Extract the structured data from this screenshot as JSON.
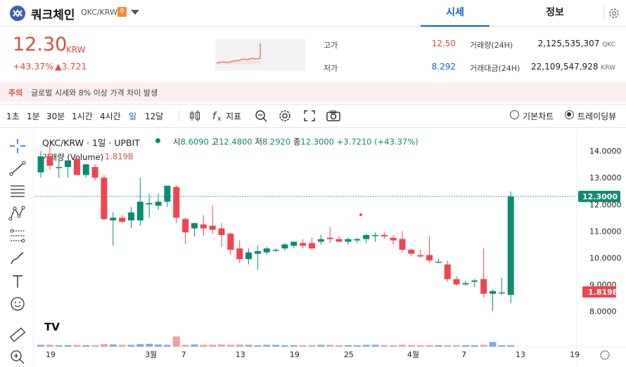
{
  "header": {
    "coin_name": "쿼크체인",
    "pair": "QKC/KRW",
    "badge": "주",
    "tabs": [
      {
        "label": "시세",
        "active": true
      },
      {
        "label": "정보",
        "active": false
      }
    ]
  },
  "summary": {
    "price": "12.30",
    "price_unit": "KRW",
    "change_pct": "+43.37%",
    "change_amt": "▲3.721",
    "high_label": "고가",
    "high_value": "12.50",
    "low_label": "저가",
    "low_value": "8.292",
    "volume_label": "거래량(24H)",
    "volume_value": "2,125,535,307",
    "volume_unit": "QKC",
    "amount_label": "거래대금(24H)",
    "amount_value": "22,109,547,928",
    "amount_unit": "KRW"
  },
  "notice": {
    "tag": "주의",
    "text": "글로벌 시세와 8% 이상 가격 차이 발생"
  },
  "toolbar": {
    "intervals": [
      "1초",
      "1분",
      "30분",
      "1시간",
      "4시간",
      "일",
      "12달"
    ],
    "selected_interval": "일",
    "indicator_label": "지표",
    "chart_modes": [
      {
        "label": "기본차트",
        "selected": false
      },
      {
        "label": "트레이딩뷰",
        "selected": true
      }
    ]
  },
  "chart_header": {
    "title": "QKC/KRW · 1일 · UPBIT",
    "open_label": "시",
    "open": "8.6090",
    "high_label": "고",
    "high": "12.4800",
    "low_label": "저",
    "low": "8.2920",
    "close_label": "종",
    "close": "12.3000",
    "change": "+3.7210 (+43.37%)",
    "volume_label": "거래량 (Volume)",
    "volume_value": "1.819B"
  },
  "colors": {
    "up": "#0e8a73",
    "down": "#f0444f",
    "price_red": "#d24f45",
    "accent_blue": "#1261c4",
    "up_vol": "#7fa8e8",
    "down_vol": "#eda0a5"
  },
  "chart_data": {
    "type": "candlestick",
    "title": "QKC/KRW · 1일 · UPBIT",
    "y_ticks": [
      "14.0000",
      "13.0000",
      "12.0000",
      "11.0000",
      "10.0000",
      "9.0000",
      "8.0000"
    ],
    "ylim": [
      7.3,
      14.4
    ],
    "x_ticks": [
      {
        "label": "19",
        "index": 1
      },
      {
        "label": "3월",
        "index": 12
      },
      {
        "label": "7",
        "index": 16
      },
      {
        "label": "13",
        "index": 22
      },
      {
        "label": "19",
        "index": 28
      },
      {
        "label": "25",
        "index": 34
      },
      {
        "label": "4월",
        "index": 41
      },
      {
        "label": "7",
        "index": 47
      },
      {
        "label": "13",
        "index": 53
      },
      {
        "label": "19",
        "index": 59
      }
    ],
    "last_price_label": "12.3000",
    "last_price": 12.3,
    "volume_label": "1.819B",
    "candles": [
      {
        "o": 13.2,
        "h": 14.0,
        "l": 13.0,
        "c": 13.8
      },
      {
        "o": 13.8,
        "h": 14.2,
        "l": 13.3,
        "c": 13.45
      },
      {
        "o": 13.4,
        "h": 13.7,
        "l": 13.0,
        "c": 13.4
      },
      {
        "o": 13.4,
        "h": 13.6,
        "l": 13.0,
        "c": 13.65
      },
      {
        "o": 13.7,
        "h": 13.75,
        "l": 13.1,
        "c": 13.1
      },
      {
        "o": 13.1,
        "h": 13.5,
        "l": 13.0,
        "c": 13.5
      },
      {
        "o": 13.4,
        "h": 13.5,
        "l": 12.9,
        "c": 13.0
      },
      {
        "o": 13.0,
        "h": 13.1,
        "l": 11.4,
        "c": 11.45
      },
      {
        "o": 11.4,
        "h": 11.7,
        "l": 10.45,
        "c": 11.5
      },
      {
        "o": 11.5,
        "h": 11.6,
        "l": 11.3,
        "c": 11.35
      },
      {
        "o": 11.4,
        "h": 11.9,
        "l": 11.1,
        "c": 11.7
      },
      {
        "o": 11.4,
        "h": 13.0,
        "l": 11.2,
        "c": 12.1
      },
      {
        "o": 12.0,
        "h": 12.4,
        "l": 11.5,
        "c": 12.05
      },
      {
        "o": 11.95,
        "h": 12.4,
        "l": 11.8,
        "c": 12.1
      },
      {
        "o": 12.1,
        "h": 12.5,
        "l": 11.9,
        "c": 12.7
      },
      {
        "o": 12.65,
        "h": 12.7,
        "l": 11.3,
        "c": 11.5
      },
      {
        "o": 11.45,
        "h": 11.5,
        "l": 10.5,
        "c": 10.95
      },
      {
        "o": 11.1,
        "h": 11.3,
        "l": 10.8,
        "c": 11.3
      },
      {
        "o": 11.25,
        "h": 11.6,
        "l": 10.8,
        "c": 11.1
      },
      {
        "o": 11.2,
        "h": 11.95,
        "l": 10.9,
        "c": 11.05
      },
      {
        "o": 11.1,
        "h": 11.3,
        "l": 10.4,
        "c": 10.85
      },
      {
        "o": 10.9,
        "h": 10.95,
        "l": 10.1,
        "c": 10.3
      },
      {
        "o": 10.35,
        "h": 10.65,
        "l": 9.8,
        "c": 9.95
      },
      {
        "o": 9.95,
        "h": 10.35,
        "l": 9.75,
        "c": 10.2
      },
      {
        "o": 10.15,
        "h": 10.45,
        "l": 9.55,
        "c": 10.25
      },
      {
        "o": 10.2,
        "h": 10.4,
        "l": 10.1,
        "c": 10.35
      },
      {
        "o": 10.3,
        "h": 10.35,
        "l": 10.2,
        "c": 10.3
      },
      {
        "o": 10.35,
        "h": 10.55,
        "l": 10.25,
        "c": 10.5
      },
      {
        "o": 10.45,
        "h": 10.6,
        "l": 10.35,
        "c": 10.6
      },
      {
        "o": 10.55,
        "h": 10.7,
        "l": 10.35,
        "c": 10.45
      },
      {
        "o": 10.55,
        "h": 10.75,
        "l": 10.3,
        "c": 10.35
      },
      {
        "o": 10.6,
        "h": 10.85,
        "l": 10.5,
        "c": 10.7
      },
      {
        "o": 10.75,
        "h": 11.15,
        "l": 10.55,
        "c": 10.7
      },
      {
        "o": 10.7,
        "h": 10.8,
        "l": 10.6,
        "c": 10.6
      },
      {
        "o": 10.6,
        "h": 10.75,
        "l": 10.5,
        "c": 10.7
      },
      {
        "o": 10.65,
        "h": 10.75,
        "l": 10.55,
        "c": 10.7
      },
      {
        "o": 10.7,
        "h": 10.9,
        "l": 10.55,
        "c": 10.85
      },
      {
        "o": 10.85,
        "h": 10.95,
        "l": 10.6,
        "c": 10.85
      },
      {
        "o": 10.85,
        "h": 10.95,
        "l": 10.7,
        "c": 10.8
      },
      {
        "o": 10.75,
        "h": 10.85,
        "l": 10.5,
        "c": 10.65
      },
      {
        "o": 10.7,
        "h": 11.0,
        "l": 10.2,
        "c": 10.3
      },
      {
        "o": 10.3,
        "h": 10.35,
        "l": 10.05,
        "c": 10.15
      },
      {
        "o": 10.1,
        "h": 10.3,
        "l": 10.0,
        "c": 10.05
      },
      {
        "o": 10.1,
        "h": 10.8,
        "l": 9.8,
        "c": 9.9
      },
      {
        "o": 9.85,
        "h": 9.95,
        "l": 9.8,
        "c": 9.85
      },
      {
        "o": 9.75,
        "h": 9.9,
        "l": 9.1,
        "c": 9.2
      },
      {
        "o": 9.2,
        "h": 9.3,
        "l": 8.95,
        "c": 9.0
      },
      {
        "o": 9.0,
        "h": 9.15,
        "l": 8.95,
        "c": 9.05
      },
      {
        "o": 9.1,
        "h": 9.2,
        "l": 8.9,
        "c": 9.15
      },
      {
        "o": 9.2,
        "h": 10.35,
        "l": 8.5,
        "c": 8.65
      },
      {
        "o": 8.65,
        "h": 8.8,
        "l": 8.0,
        "c": 8.75
      },
      {
        "o": 8.7,
        "h": 9.25,
        "l": 8.6,
        "c": 8.7
      },
      {
        "o": 8.61,
        "h": 12.48,
        "l": 8.29,
        "c": 12.3
      }
    ],
    "volumes": [
      0.05,
      0.05,
      0.04,
      0.04,
      0.05,
      0.04,
      0.04,
      0.07,
      0.06,
      0.05,
      0.05,
      0.07,
      0.08,
      0.06,
      0.05,
      0.28,
      0.05,
      0.06,
      0.05,
      0.05,
      0.06,
      0.05,
      0.06,
      0.05,
      0.04,
      0.05,
      0.05,
      0.04,
      0.04,
      0.04,
      0.04,
      0.05,
      0.05,
      0.04,
      0.04,
      0.04,
      0.05,
      0.05,
      0.04,
      0.04,
      0.05,
      0.04,
      0.04,
      0.04,
      0.04,
      0.04,
      0.04,
      0.04,
      0.04,
      0.05,
      0.13,
      0.04,
      0.04,
      0.05,
      0.04,
      0.55,
      0.25,
      0.05,
      1.819
    ],
    "volume_max": 1.819
  }
}
